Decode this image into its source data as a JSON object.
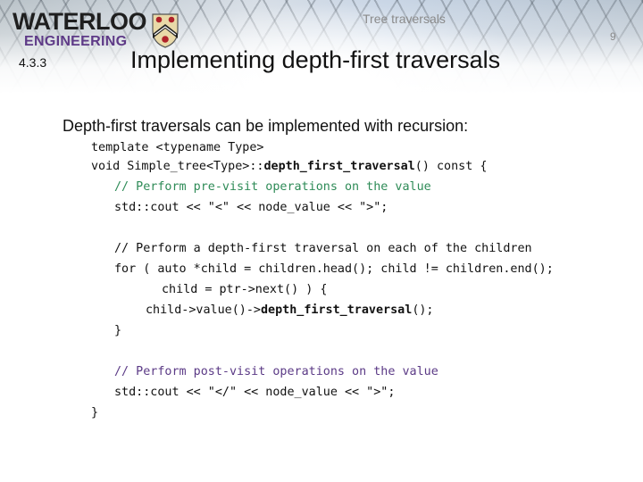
{
  "header": {
    "logo_line1": "WATERLOO",
    "logo_line2": "ENGINEERING",
    "course_title": "Tree traversals",
    "page_number": "9",
    "section_number": "4.3.3",
    "slide_title": "Implementing depth-first traversals"
  },
  "body": {
    "intro": "Depth-first traversals can be implemented with recursion:",
    "code": {
      "l1": "template <typename Type>",
      "l2_a": "void Simple_tree<Type>::",
      "l2_b": "depth_first_traversal",
      "l2_c": "() const {",
      "l3": "// Perform pre-visit operations on the value",
      "l4": "std::cout << \"<\" << node_value << \">\";",
      "l5": "// Perform a depth-first traversal on each of the children",
      "l6": "for ( auto *child = children.head(); child != children.end();",
      "l7": "child = ptr->next() ) {",
      "l8_a": "child->value()->",
      "l8_b": "depth_first_traversal",
      "l8_c": "();",
      "l9": "}",
      "l10": "// Perform post-visit operations on the value",
      "l11": "std::cout << \"</\" << node_value << \">\";",
      "l12": "}"
    }
  },
  "colors": {
    "comment_pre": "#2e8b57",
    "comment_children": "#111111",
    "comment_post": "#5b3a86",
    "engineering_purple": "#5e3a87"
  },
  "icons": {
    "crest": "university-crest-icon"
  }
}
